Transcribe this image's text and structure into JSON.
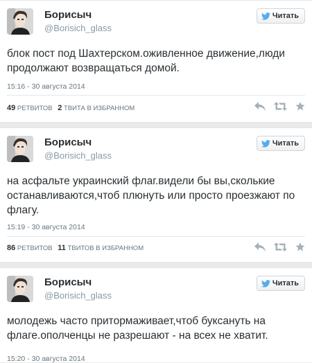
{
  "colors": {
    "background": "#eaeaea",
    "card": "#ffffff",
    "text": "#292f33",
    "muted": "#8899a6",
    "action_icons": "#a5b0b7",
    "twitter_bird": "#55acee"
  },
  "follow_label": "Читать",
  "tweets": [
    {
      "author_name": "Борисыч",
      "author_handle": "@Borisich_glass",
      "text": "блок пост под Шахтерском.оживленное движение,люди продолжают возвращаться домой.",
      "date": "15:16 - 30 августа 2014",
      "retweets_count": "49",
      "retweets_label": "ретвитов",
      "favorites_count": "2",
      "favorites_label": "твита в избранном"
    },
    {
      "author_name": "Борисыч",
      "author_handle": "@Borisich_glass",
      "text": "на асфальте украинский флаг.видели бы вы,сколькие останавливаются,чтоб плюнуть или просто проезжают по флагу.",
      "date": "15:19 - 30 августа 2014",
      "retweets_count": "86",
      "retweets_label": "ретвитов",
      "favorites_count": "11",
      "favorites_label": "твитов в избранном"
    },
    {
      "author_name": "Борисыч",
      "author_handle": "@Borisich_glass",
      "text": "молодежь часто притормаживает,чтоб буксануть на флаге.ополченцы не разрешают - на всех не хватит.",
      "date": "15:20 - 30 августа 2014"
    }
  ],
  "icons": {
    "follow": "twitter-bird-icon",
    "reply": "reply-icon",
    "retweet": "retweet-icon",
    "favorite": "star-icon"
  }
}
